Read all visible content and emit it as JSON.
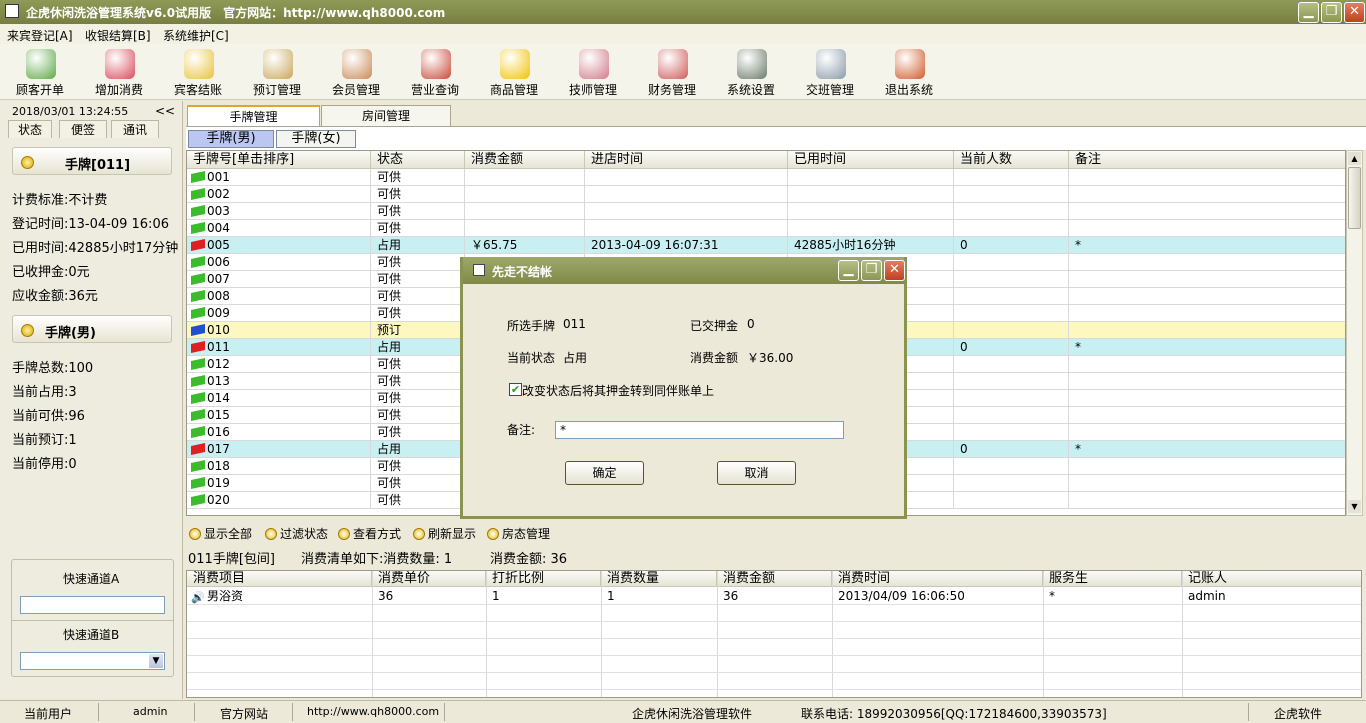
{
  "window": {
    "title": "企虎休闲洗浴管理系统v6.0试用版　官方网站：http://www.qh8000.com",
    "min": "▁",
    "max": "❐",
    "close": "✕"
  },
  "menu": [
    "来宾登记[A]",
    "收银结算[B]",
    "系统维护[C]"
  ],
  "toolbar": [
    {
      "label": "顾客开单",
      "icon": "customer-icon",
      "color": "#5da845"
    },
    {
      "label": "增加消费",
      "icon": "add-consumption-icon",
      "color": "#d94a5a"
    },
    {
      "label": "宾客结账",
      "icon": "checkout-icon",
      "color": "#e8c33a"
    },
    {
      "label": "预订管理",
      "icon": "alarm-clock-icon",
      "color": "#c9a75a"
    },
    {
      "label": "会员管理",
      "icon": "members-icon",
      "color": "#c98a5a"
    },
    {
      "label": "营业查询",
      "icon": "query-icon",
      "color": "#c84a3a"
    },
    {
      "label": "商品管理",
      "icon": "star-icon",
      "color": "#f2c200"
    },
    {
      "label": "技师管理",
      "icon": "technicians-icon",
      "color": "#d07a8a"
    },
    {
      "label": "财务管理",
      "icon": "finance-icon",
      "color": "#cf5a5a"
    },
    {
      "label": "系统设置",
      "icon": "settings-icon",
      "color": "#6a7a6a"
    },
    {
      "label": "交班管理",
      "icon": "handshake-icon",
      "color": "#8a9aa8"
    },
    {
      "label": "退出系统",
      "icon": "exit-icon",
      "color": "#d05a2a"
    }
  ],
  "left": {
    "datetime": "2018/03/01 13:24:55",
    "collapse": "<<",
    "tabs": [
      "状态",
      "便签",
      "通讯"
    ],
    "card1": {
      "title": "手牌[011]",
      "rows": [
        "计费标准:不计费",
        "登记时间:13-04-09 16:06",
        "已用时间:42885小时17分钟",
        "已收押金:0元",
        "应收金额:36元"
      ]
    },
    "card2": {
      "title": "手牌(男)",
      "rows": [
        "手牌总数:100",
        "当前占用:3",
        "当前可供:96",
        "当前预订:1",
        "当前停用:0"
      ]
    },
    "quickA": "快速通道A",
    "quickB": "快速通道B"
  },
  "maintabs": [
    "手牌管理",
    "房间管理"
  ],
  "subtabs": [
    "手牌(男)",
    "手牌(女)"
  ],
  "grid": {
    "headers": [
      "手牌号[单击排序]",
      "状态",
      "消费金额",
      "进店时间",
      "已用时间",
      "当前人数",
      "备注"
    ],
    "rows": [
      [
        "001",
        "可供",
        "",
        "",
        "",
        "",
        ""
      ],
      [
        "002",
        "可供",
        "",
        "",
        "",
        "",
        ""
      ],
      [
        "003",
        "可供",
        "",
        "",
        "",
        "",
        ""
      ],
      [
        "004",
        "可供",
        "",
        "",
        "",
        "",
        ""
      ],
      [
        "005",
        "占用",
        "￥65.75",
        "2013-04-09 16:07:31",
        "42885小时16分钟",
        "0",
        "*"
      ],
      [
        "006",
        "可供",
        "",
        "",
        "",
        "",
        ""
      ],
      [
        "007",
        "可供",
        "",
        "",
        "",
        "",
        ""
      ],
      [
        "008",
        "可供",
        "",
        "",
        "",
        "",
        ""
      ],
      [
        "009",
        "可供",
        "",
        "",
        "",
        "",
        ""
      ],
      [
        "010",
        "预订",
        "",
        "",
        "",
        "",
        ""
      ],
      [
        "011",
        "占用",
        "",
        "",
        "",
        "0",
        "*"
      ],
      [
        "012",
        "可供",
        "",
        "",
        "",
        "",
        ""
      ],
      [
        "013",
        "可供",
        "",
        "",
        "",
        "",
        ""
      ],
      [
        "014",
        "可供",
        "",
        "",
        "",
        "",
        ""
      ],
      [
        "015",
        "可供",
        "",
        "",
        "",
        "",
        ""
      ],
      [
        "016",
        "可供",
        "",
        "",
        "",
        "",
        ""
      ],
      [
        "017",
        "占用",
        "",
        "",
        "",
        "0",
        "*"
      ],
      [
        "018",
        "可供",
        "",
        "",
        "",
        "",
        ""
      ],
      [
        "019",
        "可供",
        "",
        "",
        "",
        "",
        ""
      ],
      [
        "020",
        "可供",
        "",
        "",
        "",
        "",
        ""
      ]
    ]
  },
  "actions": [
    "显示全部",
    "过滤状态",
    "查看方式",
    "刷新显示",
    "房态管理"
  ],
  "info": {
    "card": "011手牌[包间]",
    "list": "消费清单如下:消费数量: 1",
    "total": "消费金额: 36"
  },
  "grid2": {
    "headers": [
      "消费项目",
      "消费单价",
      "打折比例",
      "消费数量",
      "消费金额",
      "消费时间",
      "服务生",
      "记账人"
    ],
    "rows": [
      [
        "男浴资",
        "36",
        "1",
        "1",
        "36",
        "2013/04/09 16:06:50",
        "*",
        "admin"
      ]
    ]
  },
  "status": {
    "userLabel": "当前用户",
    "user": "admin",
    "siteLabel": "官方网站",
    "site": "http://www.qh8000.com",
    "product": "企虎休闲洗浴管理软件",
    "phone": "联系电话: 18992030956[QQ:172184600,33903573]",
    "vendor": "企虎软件"
  },
  "dialog": {
    "title": "先走不结帐",
    "selectedLabel": "所选手牌",
    "selected": "011",
    "depositLabel": "已交押金",
    "deposit": "0",
    "stateLabel": "当前状态",
    "state": "占用",
    "amountLabel": "消费金额",
    "amount": "￥36.00",
    "checkbox": "改变状态后将其押金转到同伴账单上",
    "noteLabel": "备注:",
    "note": "*",
    "ok": "确定",
    "cancel": "取消"
  },
  "colors": {
    "occupied": "#c8f0f2",
    "reserved": "#fdf7c0",
    "greenFlag": "#3cbc2c",
    "redFlag": "#e02020",
    "blueFlag": "#2050d0"
  }
}
